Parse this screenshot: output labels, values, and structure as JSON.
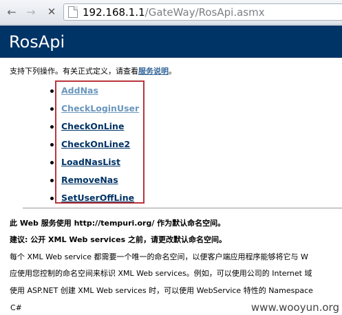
{
  "browser": {
    "address_host": "192.168.1.1",
    "address_path": "/GateWay/RosApi.asmx",
    "back_icon": "back-arrow-icon",
    "forward_icon": "forward-arrow-icon",
    "stop_icon": "close-x-icon",
    "page_icon": "page-icon"
  },
  "page": {
    "title": "RosApi",
    "intro_prefix": "支持下列操作。有关正式定义，请查看",
    "intro_link": "服务说明",
    "intro_suffix": "。",
    "operations": [
      "AddNas",
      "CheckLoginUser",
      "CheckOnLine",
      "CheckOnLine2",
      "LoadNasList",
      "RemoveNas",
      "SetUserOffLine"
    ],
    "visited_operations": [
      "AddNas",
      "CheckLoginUser"
    ],
    "namespace_line": "此 Web 服务使用 http://tempuri.org/ 作为默认命名空间。",
    "recommendation_line": "建议: 公开 XML Web services 之前，请更改默认命名空间。",
    "body_line_1": "每个 XML Web service 都需要一个唯一的命名空间，以便客户端应用程序能够将它与 W",
    "body_line_2": "应使用您控制的命名空间来标识 XML Web services。例如，可以使用公司的 Internet 域",
    "body_line_3": "使用 ASP.NET 创建 XML Web services 时，可以使用 WebService 特性的 Namespace",
    "code_label": "C#",
    "watermark": "www.wooyun.org"
  },
  "colors": {
    "banner": "#003366",
    "link": "#003366",
    "visited_link": "#6a96bd",
    "highlight_box": "#b8343a"
  }
}
